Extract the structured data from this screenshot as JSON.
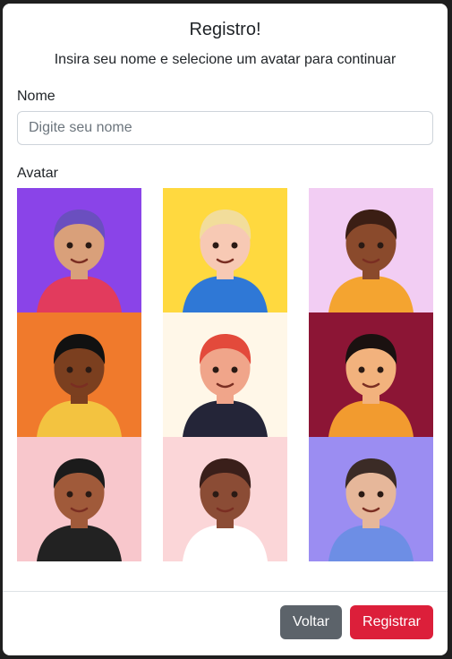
{
  "modal": {
    "title": "Registro!",
    "subtitle": "Insira seu nome e selecione um avatar para continuar"
  },
  "form": {
    "name_label": "Nome",
    "name_placeholder": "Digite seu nome",
    "name_value": "",
    "avatar_label": "Avatar"
  },
  "avatars": [
    {
      "id": "avatar-1",
      "bg": "#8a44e8",
      "skin": "#d9a07a",
      "hair": "#6a4fbf",
      "shirt": "#e23b5d"
    },
    {
      "id": "avatar-2",
      "bg": "#ffd93f",
      "skin": "#f7c9b4",
      "hair": "#f2dd9b",
      "shirt": "#2f78d6"
    },
    {
      "id": "avatar-3",
      "bg": "#f2cdf3",
      "skin": "#8a4a2c",
      "hair": "#3b1e14",
      "shirt": "#f4a430"
    },
    {
      "id": "avatar-4",
      "bg": "#f07a2c",
      "skin": "#7b3f1f",
      "hair": "#111111",
      "shirt": "#f3c340"
    },
    {
      "id": "avatar-5",
      "bg": "#fff7e8",
      "skin": "#f0a58a",
      "hair": "#e34a3b",
      "shirt": "#242538"
    },
    {
      "id": "avatar-6",
      "bg": "#8c1535",
      "skin": "#f2b27d",
      "hair": "#1a1110",
      "shirt": "#f29b2f"
    },
    {
      "id": "avatar-7",
      "bg": "#f8c7cc",
      "skin": "#a05a3a",
      "hair": "#1b1b1b",
      "shirt": "#222222"
    },
    {
      "id": "avatar-8",
      "bg": "#fbd6d8",
      "skin": "#8b4c35",
      "hair": "#3a1f1a",
      "shirt": "#ffffff"
    },
    {
      "id": "avatar-9",
      "bg": "#9b8df2",
      "skin": "#e6b79a",
      "hair": "#3b2b26",
      "shirt": "#6d8ee5"
    }
  ],
  "footer": {
    "back_label": "Voltar",
    "register_label": "Registrar",
    "back_color": "#5c636a",
    "register_color": "#dc1f3a"
  }
}
